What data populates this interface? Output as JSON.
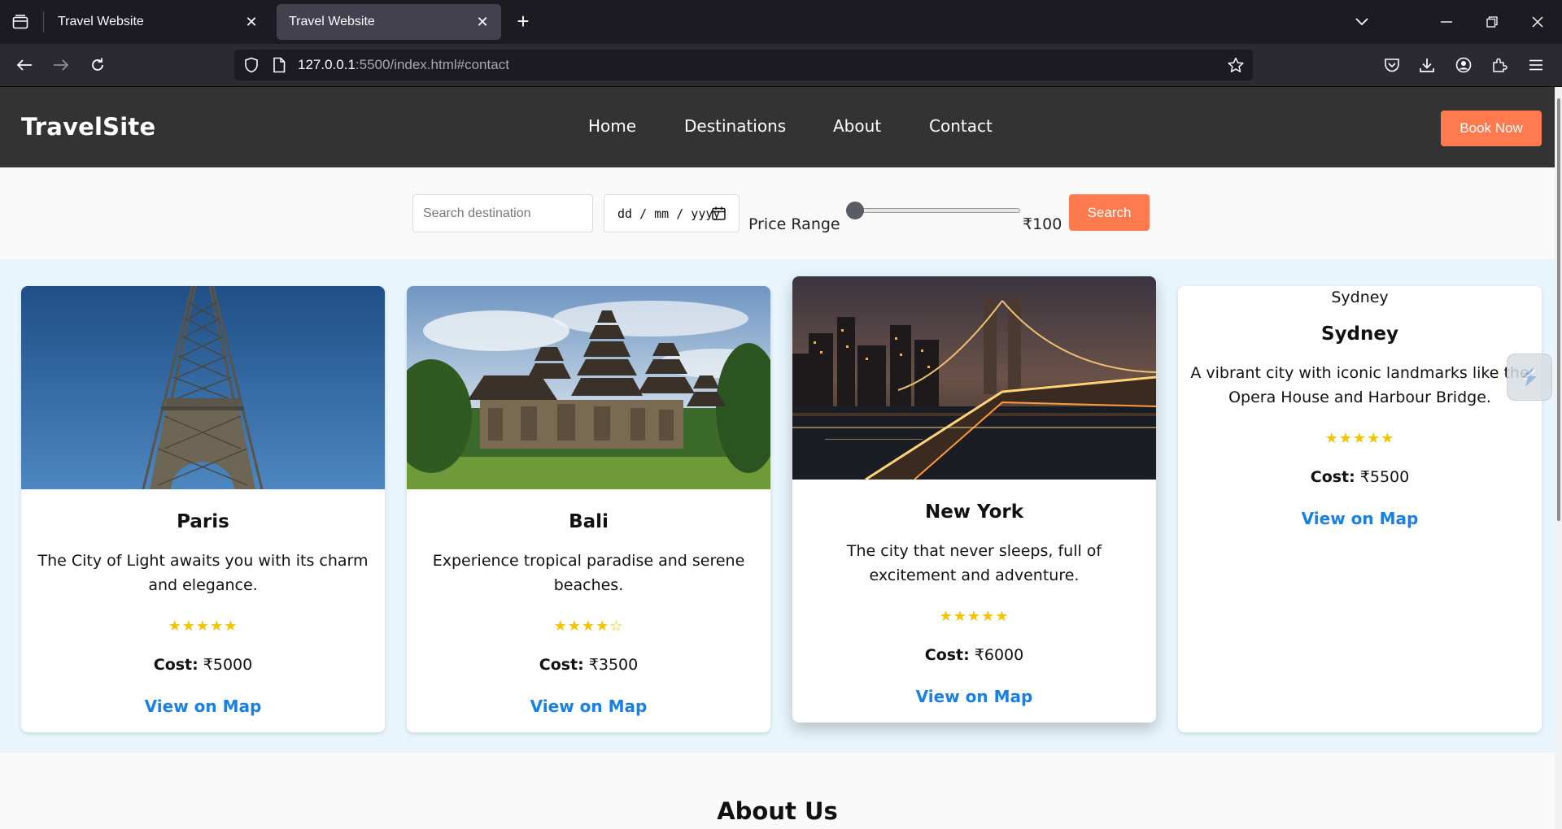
{
  "browser": {
    "tabs": [
      {
        "title": "Travel Website",
        "active": false
      },
      {
        "title": "Travel Website",
        "active": true
      }
    ],
    "url_host": "127.0.0.1",
    "url_rest": ":5500/index.html#contact"
  },
  "site": {
    "logo": "TravelSite",
    "nav": [
      "Home",
      "Destinations",
      "About",
      "Contact"
    ],
    "book_button": "Book Now",
    "accent_color": "#ff7b4f",
    "link_color": "#1a80e5"
  },
  "search": {
    "placeholder": "Search destination",
    "date_placeholder": "dd / mm / yyyy",
    "price_label": "Price Range",
    "price_value": "₹100",
    "slider_fraction": 0.0,
    "button": "Search"
  },
  "cards": [
    {
      "name": "Paris",
      "description": "The City of Light awaits you with its charm and elegance.",
      "stars": "★★★★★",
      "rating": 5,
      "cost_label": "Cost:",
      "cost": "₹5000",
      "map_link": "View on Map",
      "image": "eiffel-tower"
    },
    {
      "name": "Bali",
      "description": "Experience tropical paradise and serene beaches.",
      "stars": "★★★★☆",
      "rating": 4,
      "cost_label": "Cost:",
      "cost": "₹3500",
      "map_link": "View on Map",
      "image": "bali-temple"
    },
    {
      "name": "New York",
      "description": "The city that never sleeps, full of excitement and adventure.",
      "stars": "★★★★★",
      "rating": 5,
      "cost_label": "Cost:",
      "cost": "₹6000",
      "map_link": "View on Map",
      "image": "brooklyn-bridge-night"
    },
    {
      "name": "Sydney",
      "image_alt": "Sydney",
      "description": "A vibrant city with iconic landmarks like the Opera House and Harbour Bridge.",
      "stars": "★★★★★",
      "rating": 5,
      "cost_label": "Cost:",
      "cost": "₹5500",
      "map_link": "View on Map",
      "image": "broken-image"
    }
  ],
  "about": {
    "title": "About Us"
  }
}
